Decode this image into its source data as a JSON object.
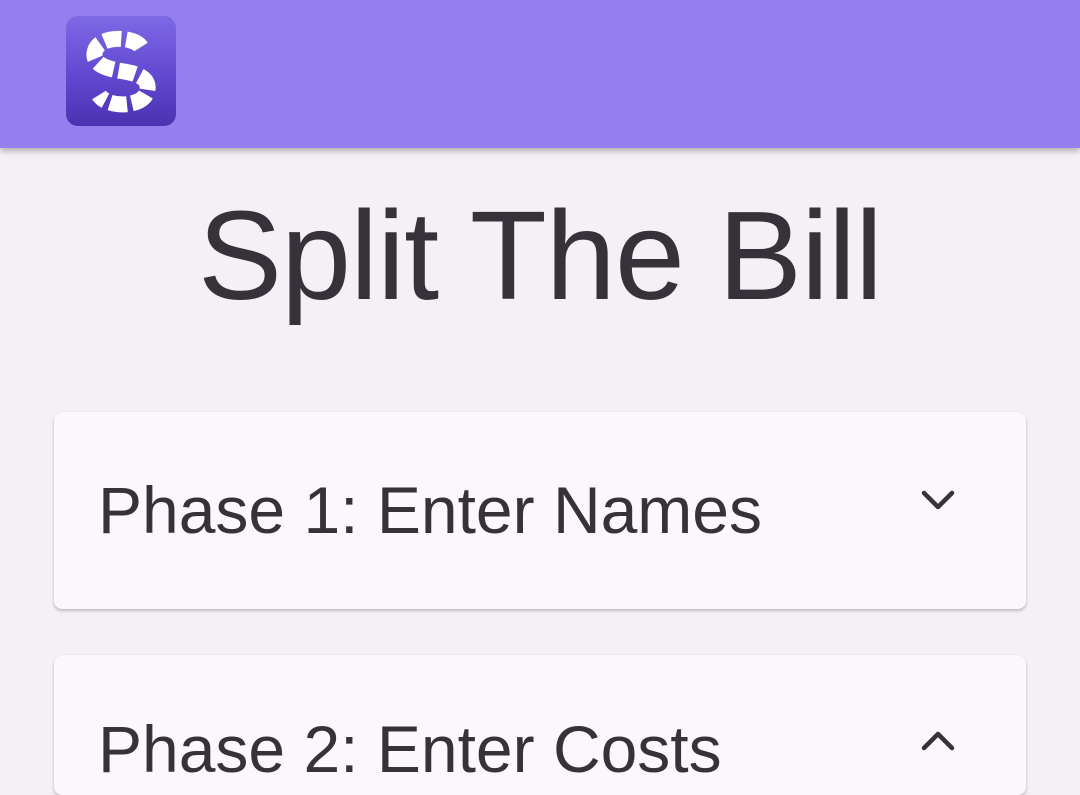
{
  "app_bar": {
    "logo_icon": "split-s-logo-icon",
    "color": "#957fef"
  },
  "page": {
    "title": "Split The Bill",
    "background": "#f4f1f6"
  },
  "phases": [
    {
      "label": "Phase 1: Enter Names",
      "expanded": false,
      "chevron_icon": "chevron-down-icon"
    },
    {
      "label": "Phase 2: Enter Costs",
      "expanded": true,
      "chevron_icon": "chevron-up-icon"
    }
  ]
}
